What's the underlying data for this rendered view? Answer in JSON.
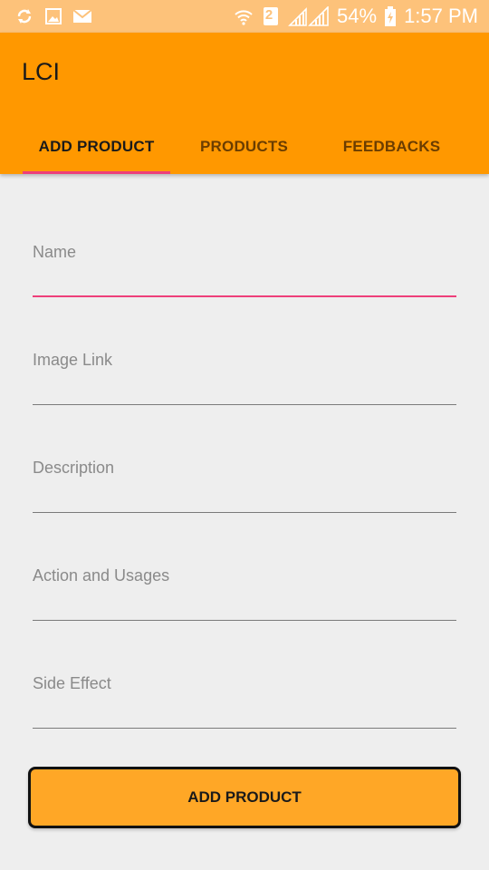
{
  "status_bar": {
    "battery": "54%",
    "time": "1:57 PM",
    "sim": "2"
  },
  "app_bar": {
    "title": "LCI",
    "background": "#ff9800"
  },
  "tabs": [
    {
      "label": "ADD PRODUCT",
      "active": true
    },
    {
      "label": "PRODUCTS",
      "active": false
    },
    {
      "label": "FEEDBACKS",
      "active": false
    }
  ],
  "form": {
    "fields": [
      {
        "label": "Name",
        "value": ""
      },
      {
        "label": "Image Link",
        "value": ""
      },
      {
        "label": "Description",
        "value": ""
      },
      {
        "label": "Action and Usages",
        "value": ""
      },
      {
        "label": "Side Effect",
        "value": ""
      }
    ],
    "submit_label": "ADD PRODUCT"
  },
  "colors": {
    "accent": "#ee3f7a",
    "primary": "#ff9800",
    "button": "#ffa726"
  },
  "icons": [
    "sync-icon",
    "image-icon",
    "mail-icon",
    "wifi-icon",
    "sim-icon",
    "signal-icon",
    "battery-icon"
  ]
}
